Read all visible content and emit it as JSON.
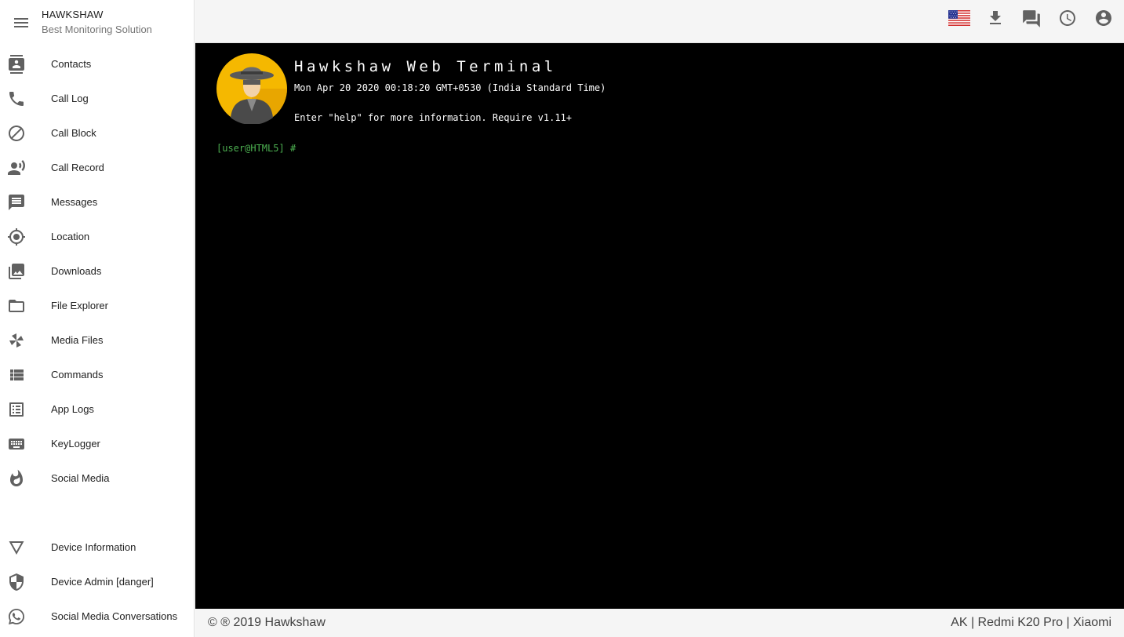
{
  "brand": {
    "title": "HAWKSHAW",
    "subtitle": "Best Monitoring Solution"
  },
  "sidebar": {
    "items": [
      {
        "label": "Contacts",
        "icon": "contacts-icon"
      },
      {
        "label": "Call Log",
        "icon": "phone-icon"
      },
      {
        "label": "Call Block",
        "icon": "block-icon"
      },
      {
        "label": "Call Record",
        "icon": "record-voice-icon"
      },
      {
        "label": "Messages",
        "icon": "message-icon"
      },
      {
        "label": "Location",
        "icon": "location-crosshair-icon"
      },
      {
        "label": "Downloads",
        "icon": "photo-library-icon"
      },
      {
        "label": "File Explorer",
        "icon": "folder-icon"
      },
      {
        "label": "Media Files",
        "icon": "pinwheel-icon"
      },
      {
        "label": "Commands",
        "icon": "list-icon"
      },
      {
        "label": "App Logs",
        "icon": "list-alt-icon"
      },
      {
        "label": "KeyLogger",
        "icon": "keyboard-icon"
      },
      {
        "label": "Social Media",
        "icon": "flame-icon"
      },
      {
        "label": "Device Information",
        "icon": "triangle-down-icon"
      },
      {
        "label": "Device Admin [danger]",
        "icon": "shield-icon"
      },
      {
        "label": "Social Media Conversations",
        "icon": "whatsapp-icon"
      }
    ]
  },
  "topbar": {
    "icons": [
      "us-flag-icon",
      "download-icon",
      "chat-icon",
      "clock-icon",
      "account-circle-icon"
    ]
  },
  "terminal": {
    "title": "Hawkshaw Web Terminal",
    "date": "Mon Apr 20 2020 00:18:20 GMT+0530 (India Standard Time)",
    "help": "Enter \"help\" for more information. Require v1.11+",
    "prompt": "[user@HTML5]",
    "prompt_symbol": "#"
  },
  "footer": {
    "left": "© ® 2019 Hawkshaw",
    "right": "AK | Redmi K20 Pro | Xiaomi"
  },
  "colors": {
    "terminal_bg": "#000000",
    "prompt_green": "#4caf50",
    "sidebar_bg": "#ffffff",
    "topbar_bg": "#f5f5f5",
    "icon_gray": "#616161"
  }
}
